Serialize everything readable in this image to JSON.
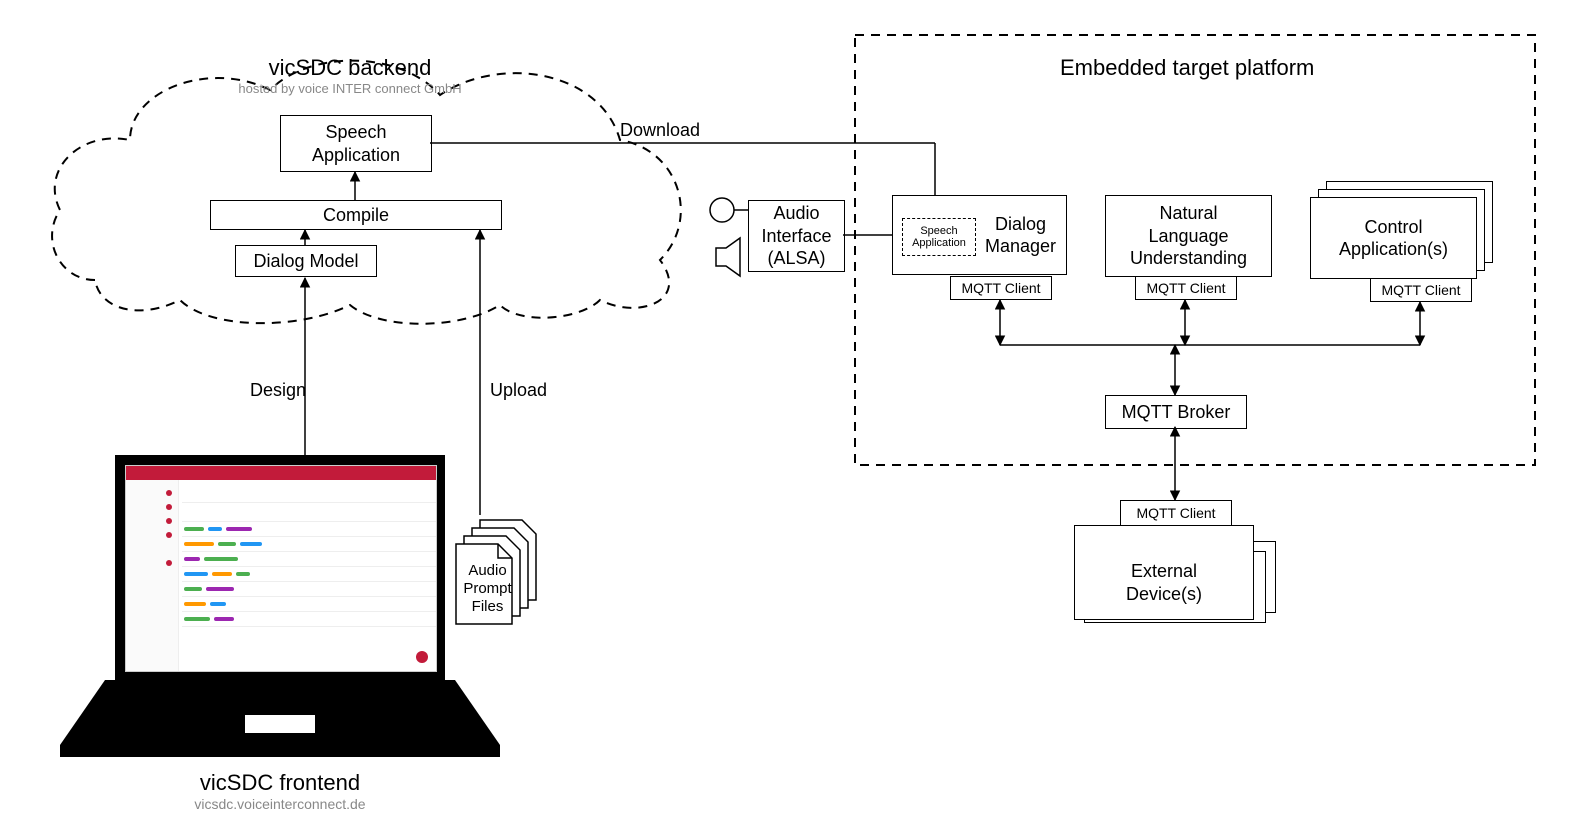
{
  "backend": {
    "title": "vicSDC backend",
    "subtitle": "hosted by voice INTER connect GmbH",
    "speech_app": "Speech\nApplication",
    "compile": "Compile",
    "dialog_model": "Dialog Model"
  },
  "arrows": {
    "design": "Design",
    "upload": "Upload",
    "download": "Download"
  },
  "frontend": {
    "title": "vicSDC frontend",
    "url": "vicsdc.voiceinterconnect.de",
    "audio_files": "Audio\nPrompt\nFiles"
  },
  "target": {
    "title": "Embedded target platform",
    "audio": "Audio\nInterface\n(ALSA)",
    "speech_app_small": "Speech\nApplication",
    "dialog_mgr": "Dialog\nManager",
    "nlu": "Natural\nLanguage\nUnderstanding",
    "control": "Control\nApplication(s)",
    "mqtt_client": "MQTT Client",
    "mqtt_broker": "MQTT Broker",
    "ext_client": "MQTT Client",
    "ext_dev": "External\nDevice(s)"
  }
}
